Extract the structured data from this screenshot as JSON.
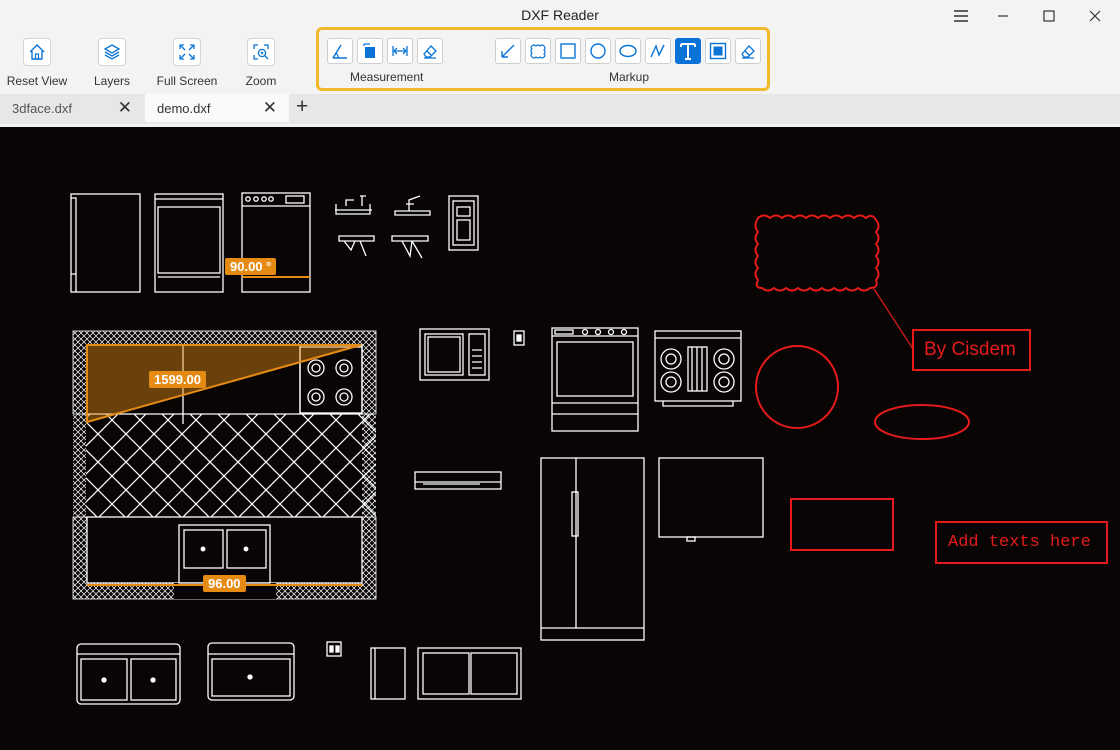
{
  "window": {
    "title": "DXF Reader"
  },
  "toolbar": {
    "reset_view": "Reset View",
    "layers": "Layers",
    "full_screen": "Full Screen",
    "zoom": "Zoom",
    "measurement_label": "Measurement",
    "markup_label": "Markup"
  },
  "tabs": [
    {
      "label": "3dface.dxf"
    },
    {
      "label": "demo.dxf"
    }
  ],
  "drawing": {
    "angle_label": "90.00 °",
    "area_label": "1599.00",
    "length_label": "96.00",
    "markup_note": "By Cisdem",
    "text_placeholder": "Add texts here"
  },
  "colors": {
    "accent": "#0a74d6",
    "highlight_border": "#f2b92b",
    "measurement": "#e58b14",
    "markup": "#e51b1b",
    "canvas_bg": "#080504"
  }
}
